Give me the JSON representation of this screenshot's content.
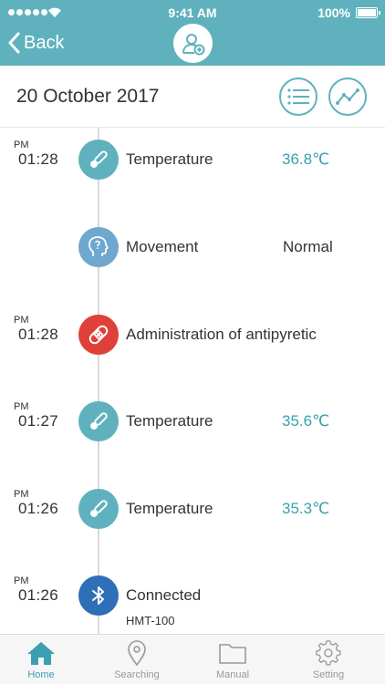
{
  "status_bar": {
    "time": "9:41 AM",
    "battery": "100%"
  },
  "header": {
    "back_label": "Back"
  },
  "date": "20 October 2017",
  "entries": [
    {
      "ampm": "PM",
      "time": "01:28",
      "label": "Temperature",
      "value": "36.8℃",
      "icon": "thermometer-icon"
    },
    {
      "ampm": "",
      "time": "",
      "label": "Movement",
      "value": "Normal",
      "icon": "head-icon"
    },
    {
      "ampm": "PM",
      "time": "01:28",
      "label": "Administration of antipyretic",
      "value": "",
      "icon": "bandage-icon"
    },
    {
      "ampm": "PM",
      "time": "01:27",
      "label": "Temperature",
      "value": "35.6℃",
      "icon": "thermometer-icon"
    },
    {
      "ampm": "PM",
      "time": "01:26",
      "label": "Temperature",
      "value": "35.3℃",
      "icon": "thermometer-icon"
    },
    {
      "ampm": "PM",
      "time": "01:26",
      "label": "Connected",
      "sublabel": "HMT-100",
      "value": "",
      "icon": "bluetooth-icon"
    }
  ],
  "tabs": [
    {
      "label": "Home",
      "icon": "home-icon",
      "active": true
    },
    {
      "label": "Searching",
      "icon": "location-pin-icon",
      "active": false
    },
    {
      "label": "Manual",
      "icon": "folder-icon",
      "active": false
    },
    {
      "label": "Setting",
      "icon": "gear-icon",
      "active": false
    }
  ],
  "colors": {
    "accent": "#5fb2bd",
    "value_text": "#3a9fb0",
    "alert": "#e0403a",
    "bluetooth": "#2f6fb8"
  }
}
